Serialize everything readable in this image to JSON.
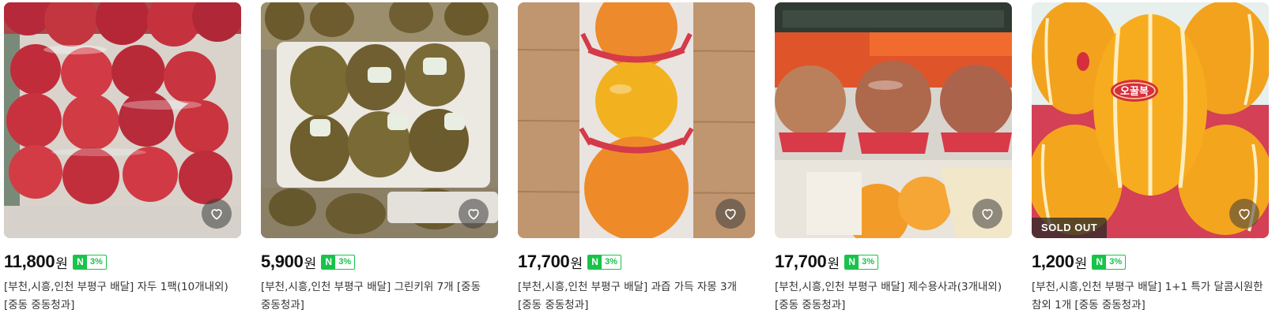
{
  "products": [
    {
      "price": "11,800",
      "unit": "원",
      "badge_icon": "N",
      "badge_rate": "3%",
      "title": "[부천,시흥,인천 부평구 배달] 자두 1팩(10개내외) [중동 중동청과]",
      "image_icon": "plum-image",
      "sold_out": false
    },
    {
      "price": "5,900",
      "unit": "원",
      "badge_icon": "N",
      "badge_rate": "3%",
      "title": "[부천,시흥,인천 부평구 배달] 그린키위 7개 [중동 중동청과]",
      "image_icon": "kiwi-image",
      "sold_out": false
    },
    {
      "price": "17,700",
      "unit": "원",
      "badge_icon": "N",
      "badge_rate": "3%",
      "title": "[부천,시흥,인천 부평구 배달] 과즙 가득 자몽 3개 [중동 중동청과]",
      "image_icon": "grapefruit-image",
      "sold_out": false
    },
    {
      "price": "17,700",
      "unit": "원",
      "badge_icon": "N",
      "badge_rate": "3%",
      "title": "[부천,시흥,인천 부평구 배달] 제수용사과(3개내외) [중동 중동청과]",
      "image_icon": "apple-image",
      "sold_out": false
    },
    {
      "price": "1,200",
      "unit": "원",
      "badge_icon": "N",
      "badge_rate": "3%",
      "title": "[부천,시흥,인천 부평구 배달] 1+1 특가 달콤시원한 참외 1개 [중동 중동청과]",
      "image_icon": "korean-melon-image",
      "sold_out": true,
      "sold_out_label": "SOLD OUT",
      "melon_sticker": "오꿀복"
    }
  ],
  "colors": {
    "npay_green": "#19c34a",
    "like_overlay": "#3c3c3c"
  }
}
